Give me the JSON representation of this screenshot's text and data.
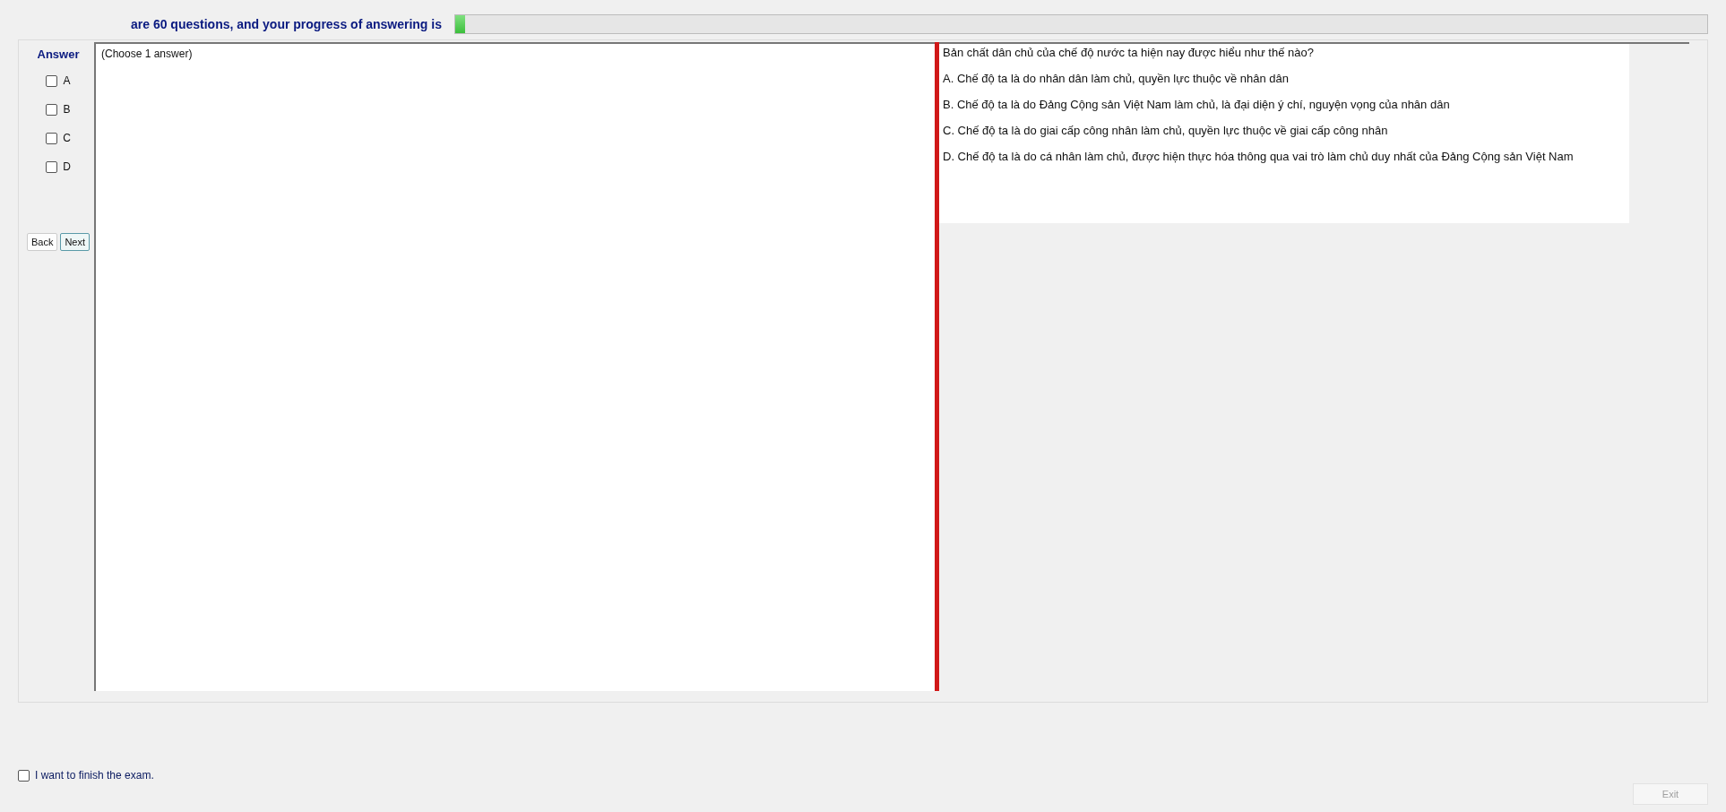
{
  "header": {
    "text": "are 60 questions, and your progress of answering is",
    "progress": {
      "level": 0.008
    }
  },
  "answer_panel": {
    "title": "Answer",
    "options": [
      {
        "label": "A",
        "checked": false
      },
      {
        "label": "B",
        "checked": false
      },
      {
        "label": "C",
        "checked": false
      },
      {
        "label": "D",
        "checked": false
      }
    ],
    "buttons": [
      {
        "label": "Back",
        "focused": false
      },
      {
        "label": "Next",
        "focused": true
      }
    ]
  },
  "answer_area": {
    "hint": "(Choose 1 answer)"
  },
  "question": {
    "text": "Bản chất dân chủ của chế độ nước ta hiện nay được hiểu như thế nào?",
    "choices": [
      "A.  Chế độ ta là do nhân dân làm chủ, quyền lực thuộc về nhân dân",
      "B.  Chế độ ta là do Đảng Cộng sản Việt Nam làm chủ, là đại diện ý chí, nguyện vọng của nhân dân",
      "C.  Chế độ ta là do giai cấp công nhân làm chủ, quyền lực thuộc về giai cấp công nhân",
      "D.  Chế độ ta là do cá nhân làm chủ, được hiện thực hóa thông qua vai trò làm chủ duy nhất của Đảng Cộng sản Việt Nam"
    ]
  },
  "finish": {
    "label": "I want to finish the exam.",
    "checked": false
  },
  "exit_button": {
    "label": "Exit",
    "disabled": true
  }
}
